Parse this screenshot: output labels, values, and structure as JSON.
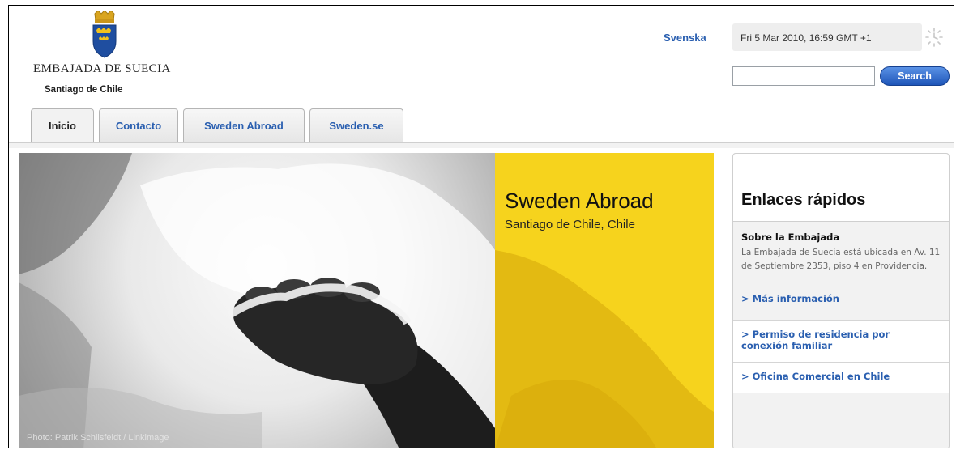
{
  "header": {
    "logo_title": "EMBAJADA DE SUECIA",
    "logo_subtitle": "Santiago de Chile",
    "language_link": "Svenska",
    "datetime": "Fri 5 Mar 2010, 16:59 GMT +1",
    "search": {
      "placeholder": "",
      "value": "",
      "button_label": "Search"
    }
  },
  "tabs": [
    {
      "label": "Inicio",
      "active": true
    },
    {
      "label": "Contacto",
      "active": false
    },
    {
      "label": "Sweden Abroad",
      "active": false
    },
    {
      "label": "Sweden.se",
      "active": false
    }
  ],
  "hero": {
    "photo_credit": "Photo: Patrik Schilsfeldt / Linkimage",
    "title": "Sweden Abroad",
    "subtitle": "Santiago de Chile, Chile"
  },
  "sidebar": {
    "title": "Enlaces rápidos",
    "about": {
      "heading": "Sobre la Embajada",
      "text": "La Embajada de Suecia está ubicada en Av. 11 de Septiembre 2353, piso 4 en Providencia.",
      "link": "> Más información"
    },
    "links": [
      "> Permiso de residencia por conexión familiar",
      "> Oficina Comercial en Chile"
    ]
  },
  "colors": {
    "accent_blue": "#2a5fb0",
    "yellow_panel": "#f6d31d"
  }
}
